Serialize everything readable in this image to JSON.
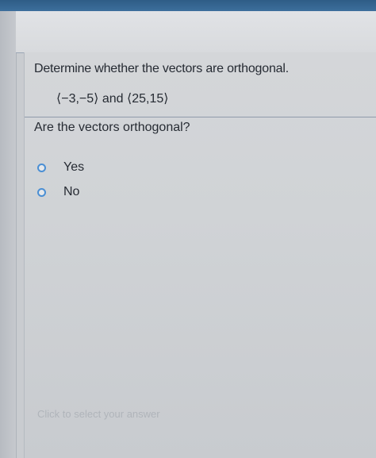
{
  "question": {
    "prompt": "Determine whether the vectors are orthogonal.",
    "vectors_text": "⟨−3,−5⟩ and ⟨25,15⟩",
    "subquestion": "Are the vectors orthogonal?"
  },
  "options": [
    {
      "label": "Yes",
      "selected": false
    },
    {
      "label": "No",
      "selected": false
    }
  ],
  "hint": "Click to select your answer",
  "colors": {
    "radio_border": "#4a8fd4",
    "header_bar": "#2e5c86",
    "text": "#262b33"
  }
}
